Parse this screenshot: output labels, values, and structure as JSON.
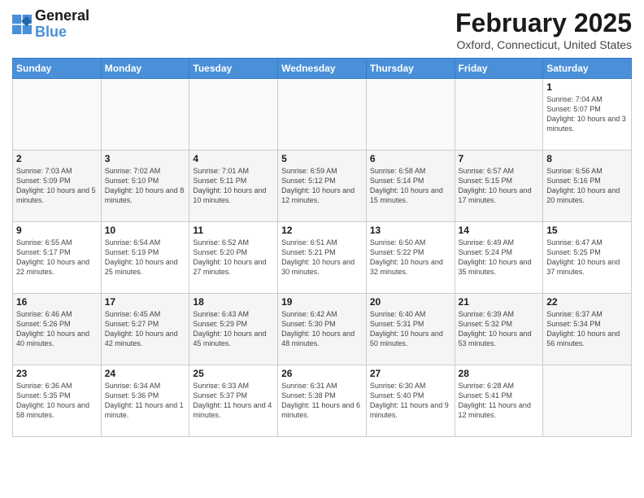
{
  "header": {
    "logo_line1": "General",
    "logo_line2": "Blue",
    "main_title": "February 2025",
    "subtitle": "Oxford, Connecticut, United States"
  },
  "days_of_week": [
    "Sunday",
    "Monday",
    "Tuesday",
    "Wednesday",
    "Thursday",
    "Friday",
    "Saturday"
  ],
  "weeks": [
    [
      {
        "day": "",
        "info": ""
      },
      {
        "day": "",
        "info": ""
      },
      {
        "day": "",
        "info": ""
      },
      {
        "day": "",
        "info": ""
      },
      {
        "day": "",
        "info": ""
      },
      {
        "day": "",
        "info": ""
      },
      {
        "day": "1",
        "info": "Sunrise: 7:04 AM\nSunset: 5:07 PM\nDaylight: 10 hours and 3 minutes."
      }
    ],
    [
      {
        "day": "2",
        "info": "Sunrise: 7:03 AM\nSunset: 5:09 PM\nDaylight: 10 hours and 5 minutes."
      },
      {
        "day": "3",
        "info": "Sunrise: 7:02 AM\nSunset: 5:10 PM\nDaylight: 10 hours and 8 minutes."
      },
      {
        "day": "4",
        "info": "Sunrise: 7:01 AM\nSunset: 5:11 PM\nDaylight: 10 hours and 10 minutes."
      },
      {
        "day": "5",
        "info": "Sunrise: 6:59 AM\nSunset: 5:12 PM\nDaylight: 10 hours and 12 minutes."
      },
      {
        "day": "6",
        "info": "Sunrise: 6:58 AM\nSunset: 5:14 PM\nDaylight: 10 hours and 15 minutes."
      },
      {
        "day": "7",
        "info": "Sunrise: 6:57 AM\nSunset: 5:15 PM\nDaylight: 10 hours and 17 minutes."
      },
      {
        "day": "8",
        "info": "Sunrise: 6:56 AM\nSunset: 5:16 PM\nDaylight: 10 hours and 20 minutes."
      }
    ],
    [
      {
        "day": "9",
        "info": "Sunrise: 6:55 AM\nSunset: 5:17 PM\nDaylight: 10 hours and 22 minutes."
      },
      {
        "day": "10",
        "info": "Sunrise: 6:54 AM\nSunset: 5:19 PM\nDaylight: 10 hours and 25 minutes."
      },
      {
        "day": "11",
        "info": "Sunrise: 6:52 AM\nSunset: 5:20 PM\nDaylight: 10 hours and 27 minutes."
      },
      {
        "day": "12",
        "info": "Sunrise: 6:51 AM\nSunset: 5:21 PM\nDaylight: 10 hours and 30 minutes."
      },
      {
        "day": "13",
        "info": "Sunrise: 6:50 AM\nSunset: 5:22 PM\nDaylight: 10 hours and 32 minutes."
      },
      {
        "day": "14",
        "info": "Sunrise: 6:49 AM\nSunset: 5:24 PM\nDaylight: 10 hours and 35 minutes."
      },
      {
        "day": "15",
        "info": "Sunrise: 6:47 AM\nSunset: 5:25 PM\nDaylight: 10 hours and 37 minutes."
      }
    ],
    [
      {
        "day": "16",
        "info": "Sunrise: 6:46 AM\nSunset: 5:26 PM\nDaylight: 10 hours and 40 minutes."
      },
      {
        "day": "17",
        "info": "Sunrise: 6:45 AM\nSunset: 5:27 PM\nDaylight: 10 hours and 42 minutes."
      },
      {
        "day": "18",
        "info": "Sunrise: 6:43 AM\nSunset: 5:29 PM\nDaylight: 10 hours and 45 minutes."
      },
      {
        "day": "19",
        "info": "Sunrise: 6:42 AM\nSunset: 5:30 PM\nDaylight: 10 hours and 48 minutes."
      },
      {
        "day": "20",
        "info": "Sunrise: 6:40 AM\nSunset: 5:31 PM\nDaylight: 10 hours and 50 minutes."
      },
      {
        "day": "21",
        "info": "Sunrise: 6:39 AM\nSunset: 5:32 PM\nDaylight: 10 hours and 53 minutes."
      },
      {
        "day": "22",
        "info": "Sunrise: 6:37 AM\nSunset: 5:34 PM\nDaylight: 10 hours and 56 minutes."
      }
    ],
    [
      {
        "day": "23",
        "info": "Sunrise: 6:36 AM\nSunset: 5:35 PM\nDaylight: 10 hours and 58 minutes."
      },
      {
        "day": "24",
        "info": "Sunrise: 6:34 AM\nSunset: 5:36 PM\nDaylight: 11 hours and 1 minute."
      },
      {
        "day": "25",
        "info": "Sunrise: 6:33 AM\nSunset: 5:37 PM\nDaylight: 11 hours and 4 minutes."
      },
      {
        "day": "26",
        "info": "Sunrise: 6:31 AM\nSunset: 5:38 PM\nDaylight: 11 hours and 6 minutes."
      },
      {
        "day": "27",
        "info": "Sunrise: 6:30 AM\nSunset: 5:40 PM\nDaylight: 11 hours and 9 minutes."
      },
      {
        "day": "28",
        "info": "Sunrise: 6:28 AM\nSunset: 5:41 PM\nDaylight: 11 hours and 12 minutes."
      },
      {
        "day": "",
        "info": ""
      }
    ]
  ]
}
